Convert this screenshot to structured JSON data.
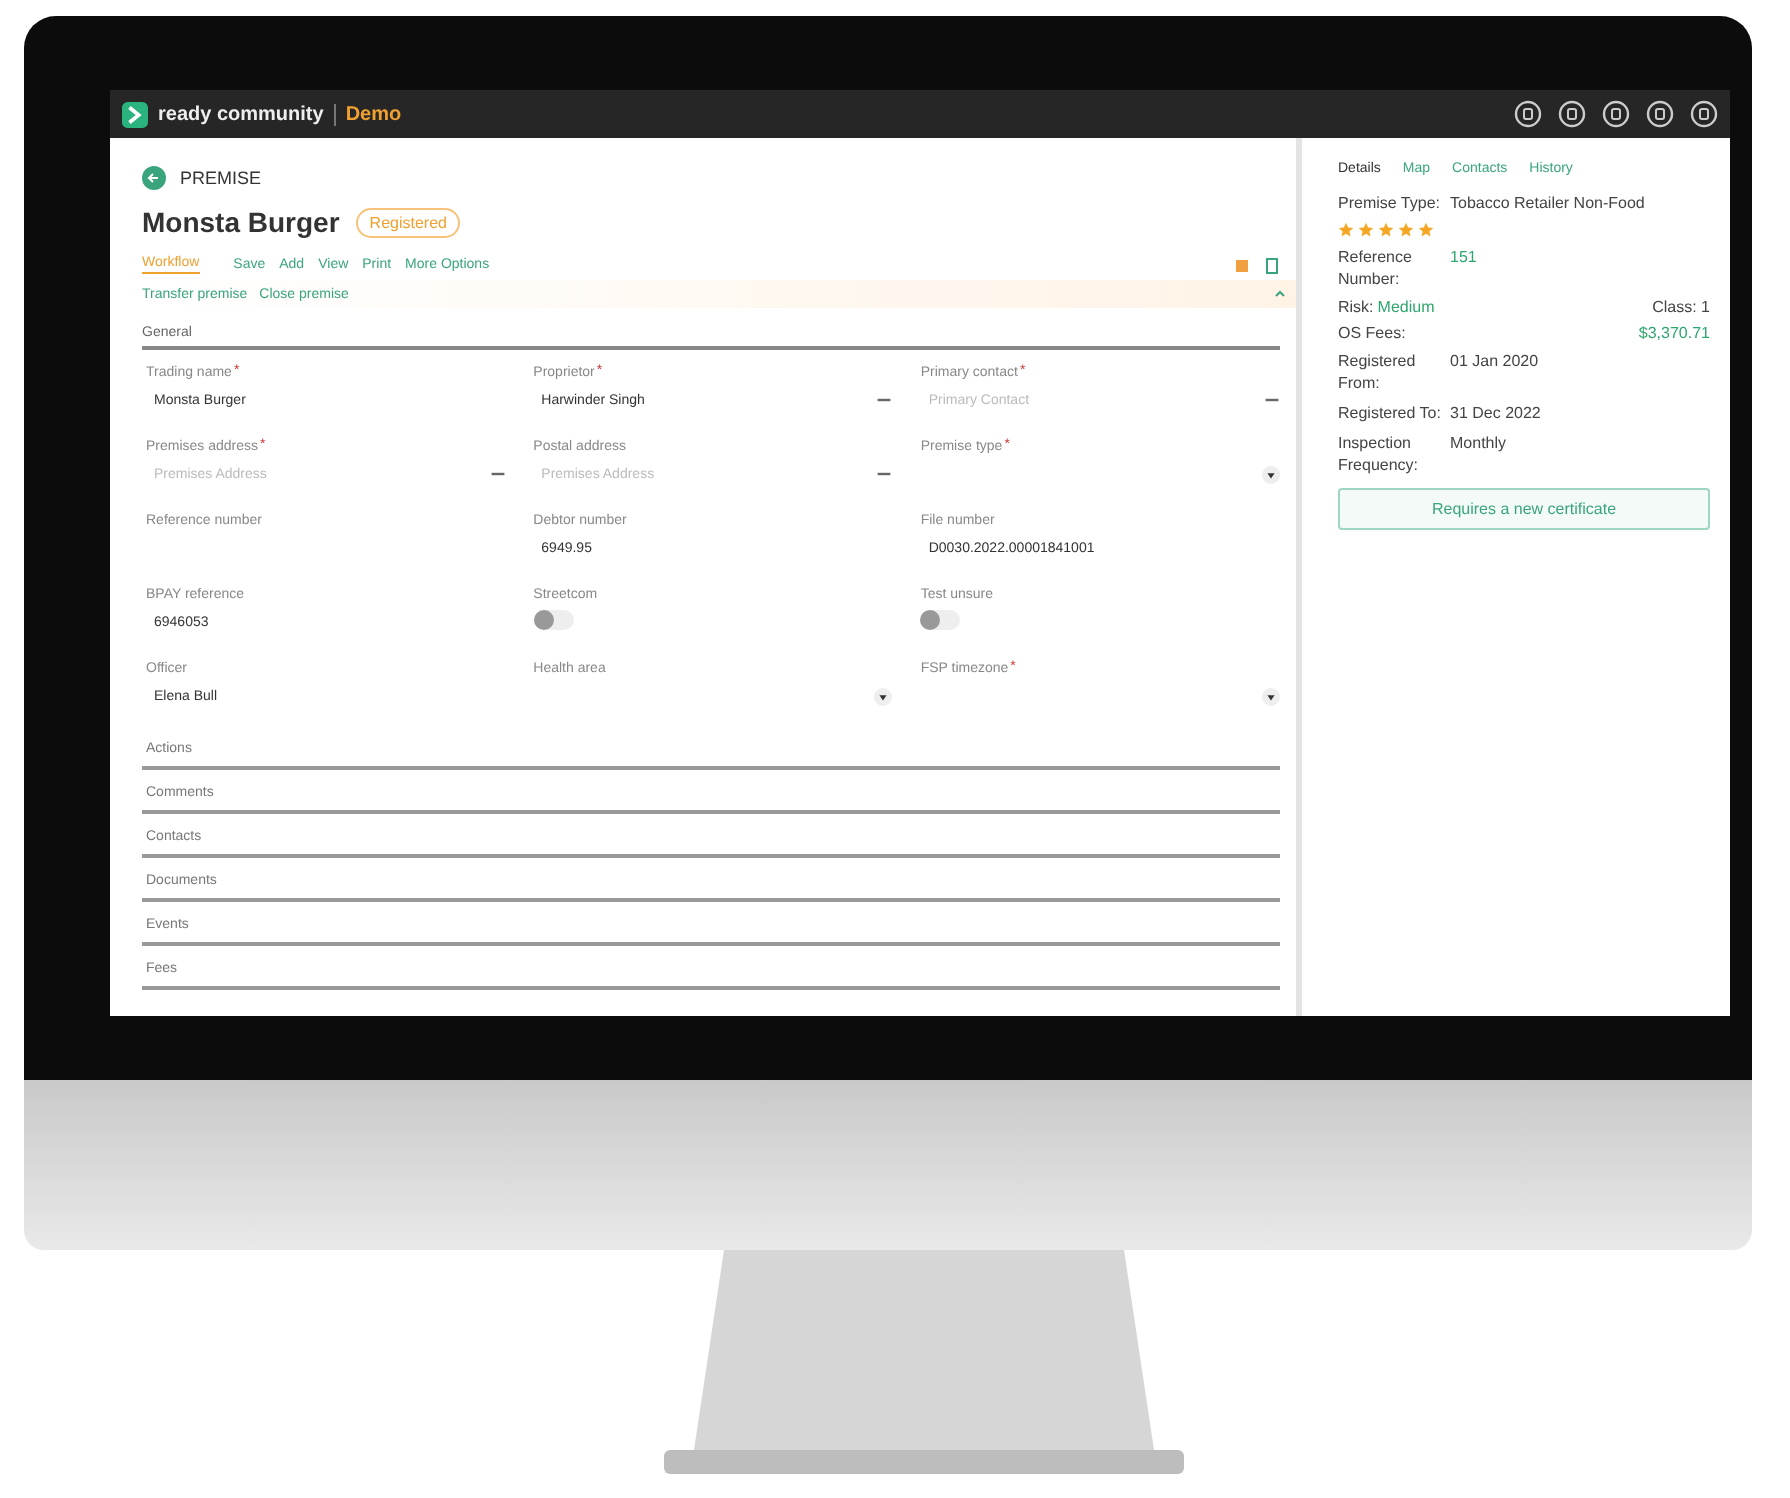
{
  "app": {
    "name": "ready community",
    "environment": "Demo"
  },
  "header": {
    "section": "PREMISE",
    "title": "Monsta Burger",
    "status": "Registered"
  },
  "toolbar": [
    {
      "label": "Workflow",
      "selected": true
    },
    {
      "label": "Save",
      "selected": false
    },
    {
      "label": "Add",
      "selected": false
    },
    {
      "label": "View",
      "selected": false
    },
    {
      "label": "Print",
      "selected": false
    },
    {
      "label": "More Options",
      "selected": false
    }
  ],
  "actions": [
    "Transfer premise",
    "Close premise"
  ],
  "general": {
    "title": "General",
    "fields": [
      {
        "kind": "text",
        "label": "Trading name",
        "required_mark": "*",
        "value": "Monsta Burger"
      },
      {
        "kind": "lookup",
        "label": "Proprietor",
        "required_mark": "*",
        "value": "Harwinder Singh"
      },
      {
        "kind": "lookup",
        "label": "Primary contact",
        "required_mark": "*",
        "placeholder": "Primary Contact"
      },
      {
        "kind": "lookup",
        "label": "Premises address",
        "required_mark": "*",
        "placeholder": "Premises Address"
      },
      {
        "kind": "lookup",
        "label": "Postal address",
        "placeholder": "Premises Address"
      },
      {
        "kind": "select",
        "label": "Premise type",
        "required_mark": "*"
      },
      {
        "kind": "text",
        "label": "Reference number"
      },
      {
        "kind": "text",
        "label": "Debtor number",
        "value": "6949.95"
      },
      {
        "kind": "text",
        "label": "File number",
        "value": "D0030.2022.00001841001"
      },
      {
        "kind": "text",
        "label": "BPAY reference",
        "value": "6946053"
      },
      {
        "kind": "toggle",
        "label": "Streetcom",
        "on": false
      },
      {
        "kind": "toggle",
        "label": "Test unsure",
        "on": false
      },
      {
        "kind": "text",
        "label": "Officer",
        "value": "Elena Bull"
      },
      {
        "kind": "select",
        "label": "Health area"
      },
      {
        "kind": "select",
        "label": "FSP timezone",
        "required_mark": "*"
      }
    ]
  },
  "sections": [
    "Actions",
    "Comments",
    "Contacts",
    "Documents",
    "Events",
    "Fees"
  ],
  "side_tabs": [
    {
      "label": "Details",
      "selected": true
    },
    {
      "label": "Map",
      "selected": false
    },
    {
      "label": "Contacts",
      "selected": false
    },
    {
      "label": "History",
      "selected": false
    }
  ],
  "details": {
    "premise_type_label": "Premise Type:",
    "premise_type": "Tobacco Retailer Non-Food",
    "stars": 5,
    "reference_label": "Reference Number:",
    "reference": "151",
    "risk_label": "Risk:",
    "risk": "Medium",
    "class": "Class: 1",
    "fees_label": "OS Fees:",
    "fees": "$3,370.71",
    "rows": [
      {
        "label": "Registered From:",
        "value": "01 Jan 2020"
      },
      {
        "label": "Registered To:",
        "value": "31 Dec 2022"
      },
      {
        "label": "Inspection Frequency:",
        "value": "Monthly"
      }
    ],
    "button": "Requires a new certificate"
  }
}
